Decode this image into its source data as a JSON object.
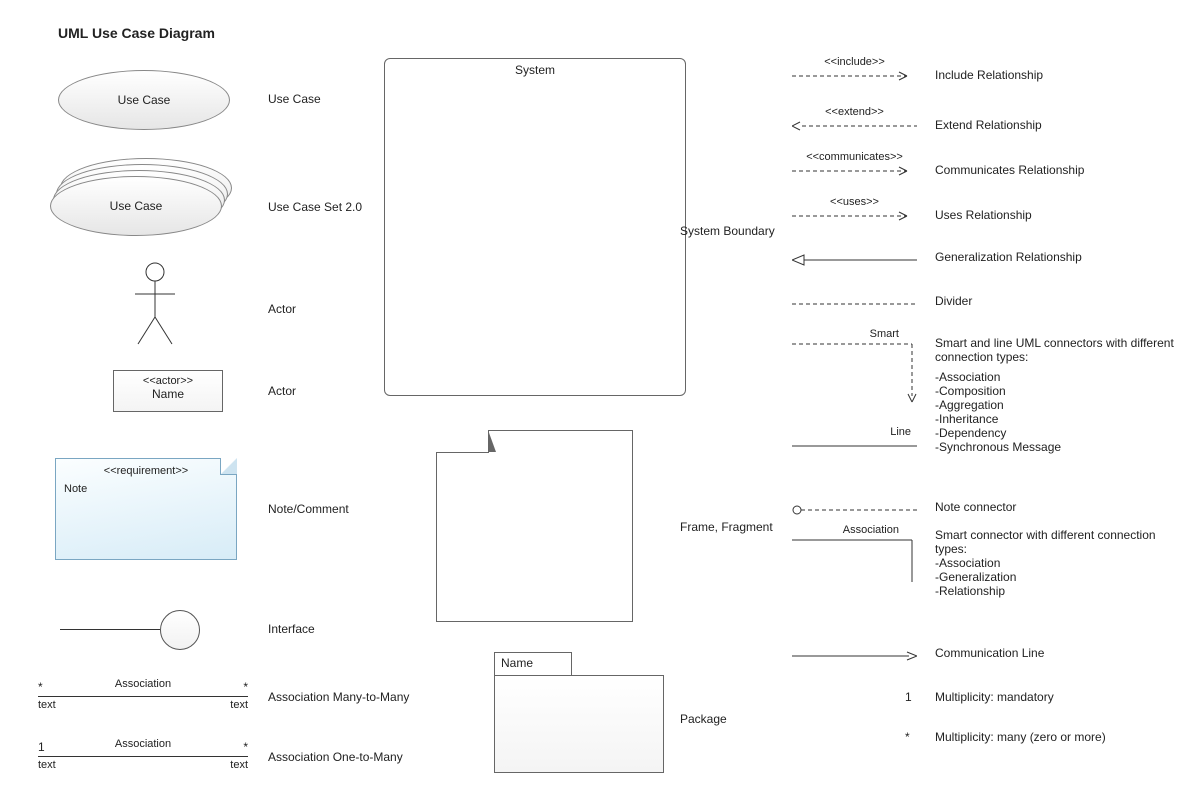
{
  "title": "UML Use Case Diagram",
  "left": {
    "usecase": {
      "text": "Use Case",
      "label": "Use Case"
    },
    "usecase_set": {
      "text": "Use Case",
      "label": "Use Case Set 2.0"
    },
    "actor_stick_label": "Actor",
    "actor_box": {
      "stereotype": "<<actor>>",
      "name": "Name",
      "label": "Actor"
    },
    "note": {
      "stereotype": "<<requirement>>",
      "text": "Note",
      "label": "Note/Comment"
    },
    "interface_label": "Interface",
    "assoc_many": {
      "left_mult": "*",
      "right_mult": "*",
      "name": "Association",
      "left_txt": "text",
      "right_txt": "text",
      "label": "Association Many-to-Many"
    },
    "assoc_one": {
      "left_mult": "1",
      "right_mult": "*",
      "name": "Association",
      "left_txt": "text",
      "right_txt": "text",
      "label": "Association One-to-Many"
    }
  },
  "center": {
    "system_title": "System",
    "system_label": "System Boundary",
    "frame_label": "Frame, Fragment",
    "package_name": "Name",
    "package_label": "Package"
  },
  "right": {
    "include": {
      "stereo": "<<include>>",
      "label": "Include Relationship"
    },
    "extend": {
      "stereo": "<<extend>>",
      "label": "Extend Relationship"
    },
    "communicates": {
      "stereo": "<<communicates>>",
      "label": "Communicates Relationship"
    },
    "uses": {
      "stereo": "<<uses>>",
      "label": "Uses Relationship"
    },
    "generalization_label": "Generalization Relationship",
    "divider_label": "Divider",
    "smart_label": "Smart",
    "line_label": "Line",
    "smart_line_text": "Smart and line UML connectors with different connection types:",
    "conn_types": [
      "-Association",
      "-Composition",
      "-Aggregation",
      "-Inheritance",
      "-Dependency",
      "-Synchronous Message"
    ],
    "note_connector_label": "Note connector",
    "association_label": "Association",
    "assoc_smart_text": "Smart connector with different connection types:",
    "assoc_types": [
      "-Association",
      "-Generalization",
      "-Relationship"
    ],
    "comm_line_label": "Communication Line",
    "mult_1_symbol": "1",
    "mult_1_label": "Multiplicity: mandatory",
    "mult_many_symbol": "*",
    "mult_many_label": "Multiplicity: many (zero or more)"
  }
}
